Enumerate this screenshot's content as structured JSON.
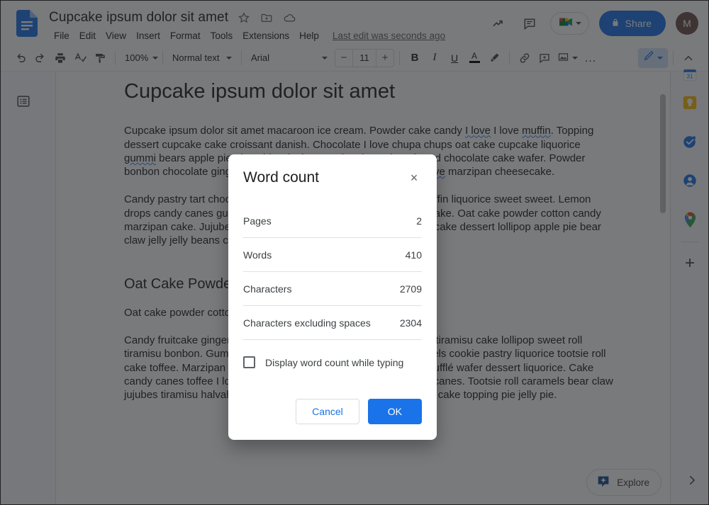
{
  "app": {
    "doc_title": "Cupcake ipsum dolor sit amet",
    "last_edit": "Last edit was seconds ago",
    "avatar_initial": "M",
    "share_label": "Share",
    "icons": {
      "docs_logo": "google-docs-logo-icon",
      "star": "star-icon",
      "move_folder": "move-to-folder-icon",
      "cloud": "cloud-saved-icon",
      "activity": "activity-trend-icon",
      "comments": "comment-history-icon",
      "meet": "google-meet-icon",
      "lock": "lock-icon"
    }
  },
  "menu": {
    "items": [
      {
        "label": "File"
      },
      {
        "label": "Edit"
      },
      {
        "label": "View"
      },
      {
        "label": "Insert"
      },
      {
        "label": "Format"
      },
      {
        "label": "Tools"
      },
      {
        "label": "Extensions"
      },
      {
        "label": "Help"
      }
    ]
  },
  "toolbar": {
    "zoom": "100%",
    "paragraph_style": "Normal text",
    "font_family": "Arial",
    "font_size": "11",
    "decrease_label": "−",
    "increase_label": "+",
    "bold": "B",
    "italic": "I",
    "underline": "U",
    "text_color": "A",
    "more_label": "…"
  },
  "document": {
    "heading1": "Cupcake ipsum dolor sit amet",
    "heading2": "Oat Cake Powder",
    "paragraph1_a": "Cupcake ipsum dolor sit amet macaroon ice cream. Powder cake candy ",
    "paragraph1_sp1": "I love",
    "paragraph1_b": " I love ",
    "paragraph1_sp2": "muffin",
    "paragraph1_c": ". Topping dessert cupcake cake croissant danish. Chocolate I love chupa chups oat cake cupcake liquorice ",
    "paragraph1_sp3": "gummi",
    "paragraph1_d": " bears apple pie I love biscuit cheesecake I love gingerbread chocolate cake wafer. Powder bonbon chocolate gingerbread jelly beans I love donut ",
    "paragraph1_sp4": "topping I love",
    "paragraph1_e": " marzipan cheesecake.",
    "paragraph2": "Candy pastry tart chocolate bar tart sesame snaps cake donut muffin liquorice sweet sweet. Lemon drops candy canes gummi bears powder I love sweet roll halvah cake. Oat cake powder cotton candy marzipan cake. Jujubes icing chocolate cake candy canes cheesecake dessert lollipop apple pie bear claw jelly jelly beans croissant.",
    "paragraph3": "Oat cake powder cotton candy marzipan cake.",
    "paragraph4": "Candy fruitcake gingerbread carrot cake chocolate danish jujubes tiramisu cake lollipop sweet roll tiramisu bonbon. Gummies candy canes sugar plum cake. Caramels cookie pastry liquorice tootsie roll cake toffee. Marzipan brownie marshmallow gingerbread I love soufflé wafer dessert liquorice. Cake candy canes toffee I love marshmallow sugar plum jujubes candy canes. Tootsie roll caramels bear claw jujubes tiramisu halvah shortbread gingerbread. Dragée chocolate cake topping pie jelly pie."
  },
  "right_rail": {
    "items": [
      {
        "name": "google-calendar-icon"
      },
      {
        "name": "google-keep-icon"
      },
      {
        "name": "google-tasks-icon"
      },
      {
        "name": "google-contacts-icon"
      },
      {
        "name": "google-maps-icon"
      }
    ],
    "add_label": "+"
  },
  "explore": {
    "label": "Explore"
  },
  "dialog": {
    "title": "Word count",
    "close_label": "×",
    "stats": [
      {
        "label": "Pages",
        "value": "2"
      },
      {
        "label": "Words",
        "value": "410"
      },
      {
        "label": "Characters",
        "value": "2709"
      },
      {
        "label": "Characters excluding spaces",
        "value": "2304"
      }
    ],
    "checkbox_label": "Display word count while typing",
    "checkbox_checked": false,
    "cancel_label": "Cancel",
    "ok_label": "OK"
  },
  "colors": {
    "accent_blue": "#1a73e8",
    "scrim": "rgba(32,33,36,0.60)",
    "text_primary": "#202124",
    "text_secondary": "#5f6368"
  }
}
